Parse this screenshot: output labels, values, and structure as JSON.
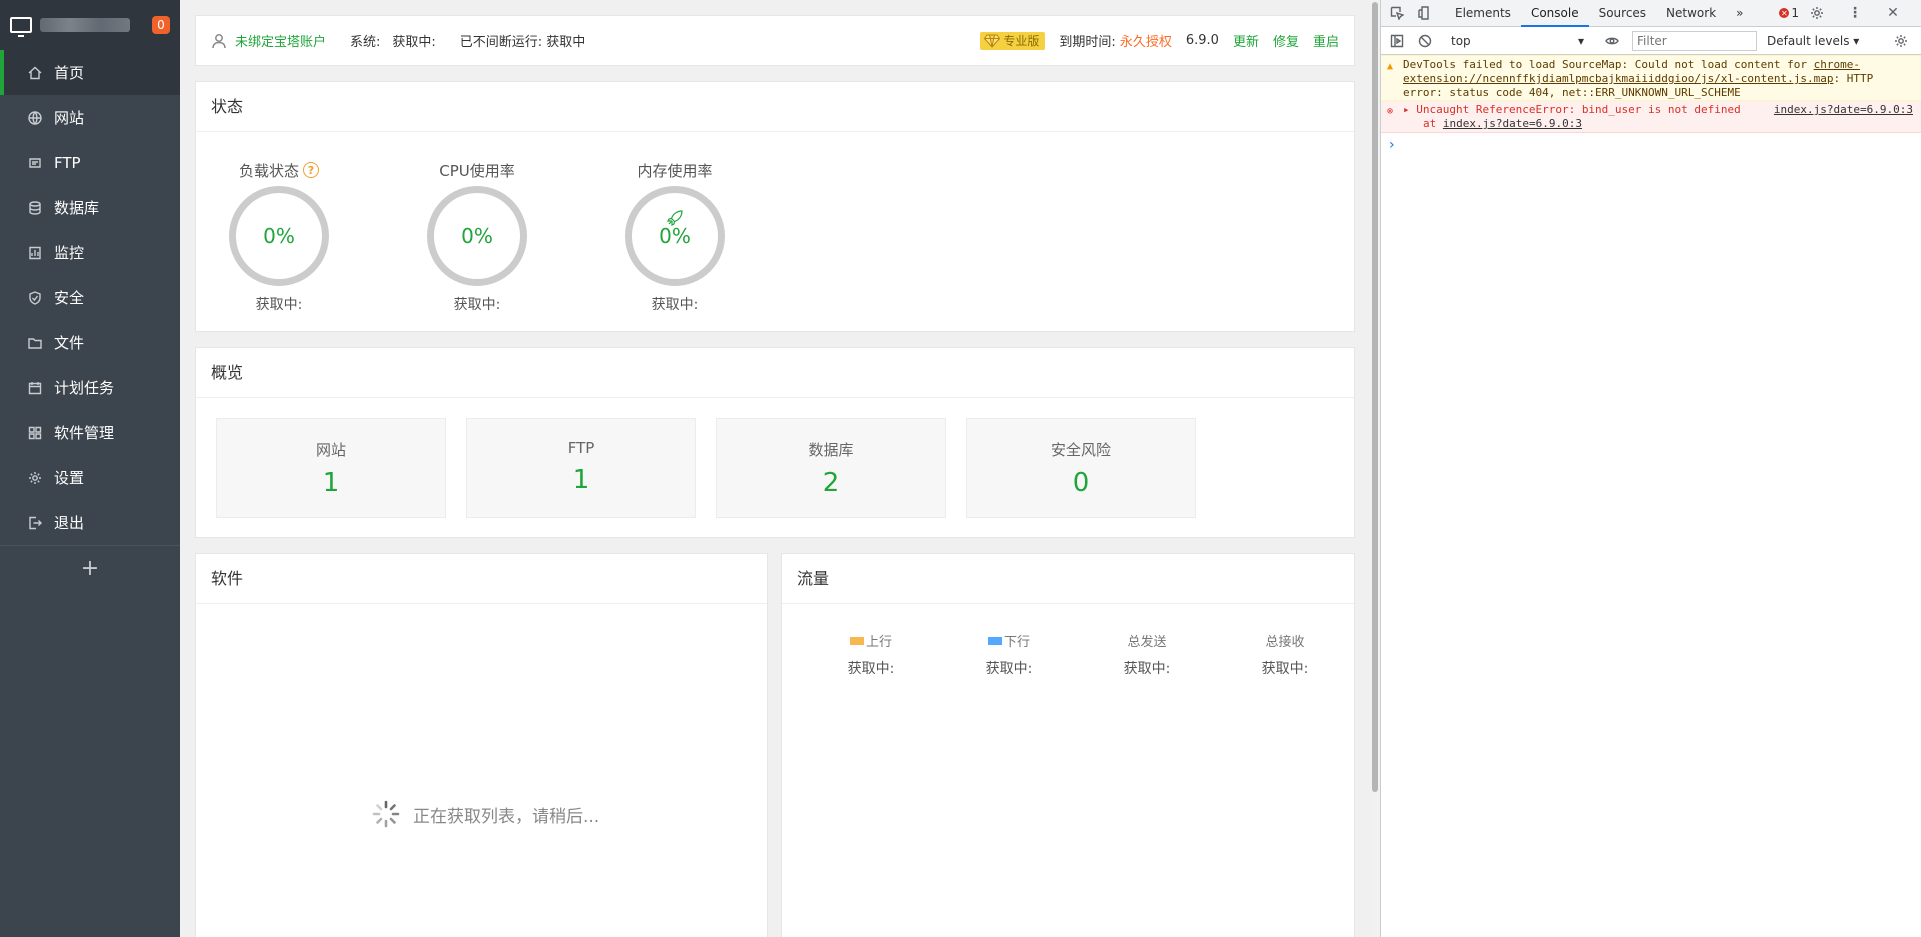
{
  "sidebar": {
    "badge": "0",
    "items": [
      {
        "label": "首页",
        "icon": "home-icon"
      },
      {
        "label": "网站",
        "icon": "globe-icon"
      },
      {
        "label": "FTP",
        "icon": "ftp-icon"
      },
      {
        "label": "数据库",
        "icon": "database-icon"
      },
      {
        "label": "监控",
        "icon": "monitor-icon"
      },
      {
        "label": "安全",
        "icon": "shield-icon"
      },
      {
        "label": "文件",
        "icon": "folder-icon"
      },
      {
        "label": "计划任务",
        "icon": "calendar-icon"
      },
      {
        "label": "软件管理",
        "icon": "grid-icon"
      },
      {
        "label": "设置",
        "icon": "gear-icon"
      },
      {
        "label": "退出",
        "icon": "logout-icon"
      }
    ],
    "add": "+"
  },
  "topbar": {
    "account": "未绑定宝塔账户",
    "system_label": "系统:",
    "system_value": "获取中:",
    "uptime": "已不间断运行: 获取中",
    "pro": "专业版",
    "expire_label": "到期时间:",
    "expire_value": "永久授权",
    "version": "6.9.0",
    "update": "更新",
    "repair": "修复",
    "restart": "重启"
  },
  "status": {
    "title": "状态",
    "gauges": [
      {
        "label": "负载状态",
        "value": "0%",
        "sub": "获取中:",
        "help": "?"
      },
      {
        "label": "CPU使用率",
        "value": "0%",
        "sub": "获取中:"
      },
      {
        "label": "内存使用率",
        "value": "0%",
        "sub": "获取中:"
      }
    ]
  },
  "overview": {
    "title": "概览",
    "boxes": [
      {
        "label": "网站",
        "value": "1"
      },
      {
        "label": "FTP",
        "value": "1"
      },
      {
        "label": "数据库",
        "value": "2"
      },
      {
        "label": "安全风险",
        "value": "0"
      }
    ]
  },
  "software": {
    "title": "软件",
    "loading": "正在获取列表，请稍后..."
  },
  "traffic": {
    "title": "流量",
    "cols": [
      {
        "label": "上行",
        "value": "获取中:",
        "color": "#f7b851"
      },
      {
        "label": "下行",
        "value": "获取中:",
        "color": "#52a9ff"
      },
      {
        "label": "总发送",
        "value": "获取中:"
      },
      {
        "label": "总接收",
        "value": "获取中:"
      }
    ]
  },
  "devtools": {
    "tabs": [
      "Elements",
      "Console",
      "Sources",
      "Network"
    ],
    "more": "»",
    "error_count": "1",
    "context": "top",
    "filter_placeholder": "Filter",
    "levels": "Default levels ▾",
    "warning": {
      "text1": "DevTools failed to load SourceMap: Could not load content for ",
      "link": "chrome-extension://ncennffkjdiamlpmcbajkmaiiiddgioo/js/xl-content.js.map",
      "text2": ": HTTP error: status code 404, net::ERR_UNKNOWN_URL_SCHEME"
    },
    "error": {
      "text": "Uncaught ReferenceError: bind_user is not defined",
      "src": "index.js?date=6.9.0:3",
      "at_label": "at ",
      "at_link": "index.js?date=6.9.0:3"
    }
  }
}
